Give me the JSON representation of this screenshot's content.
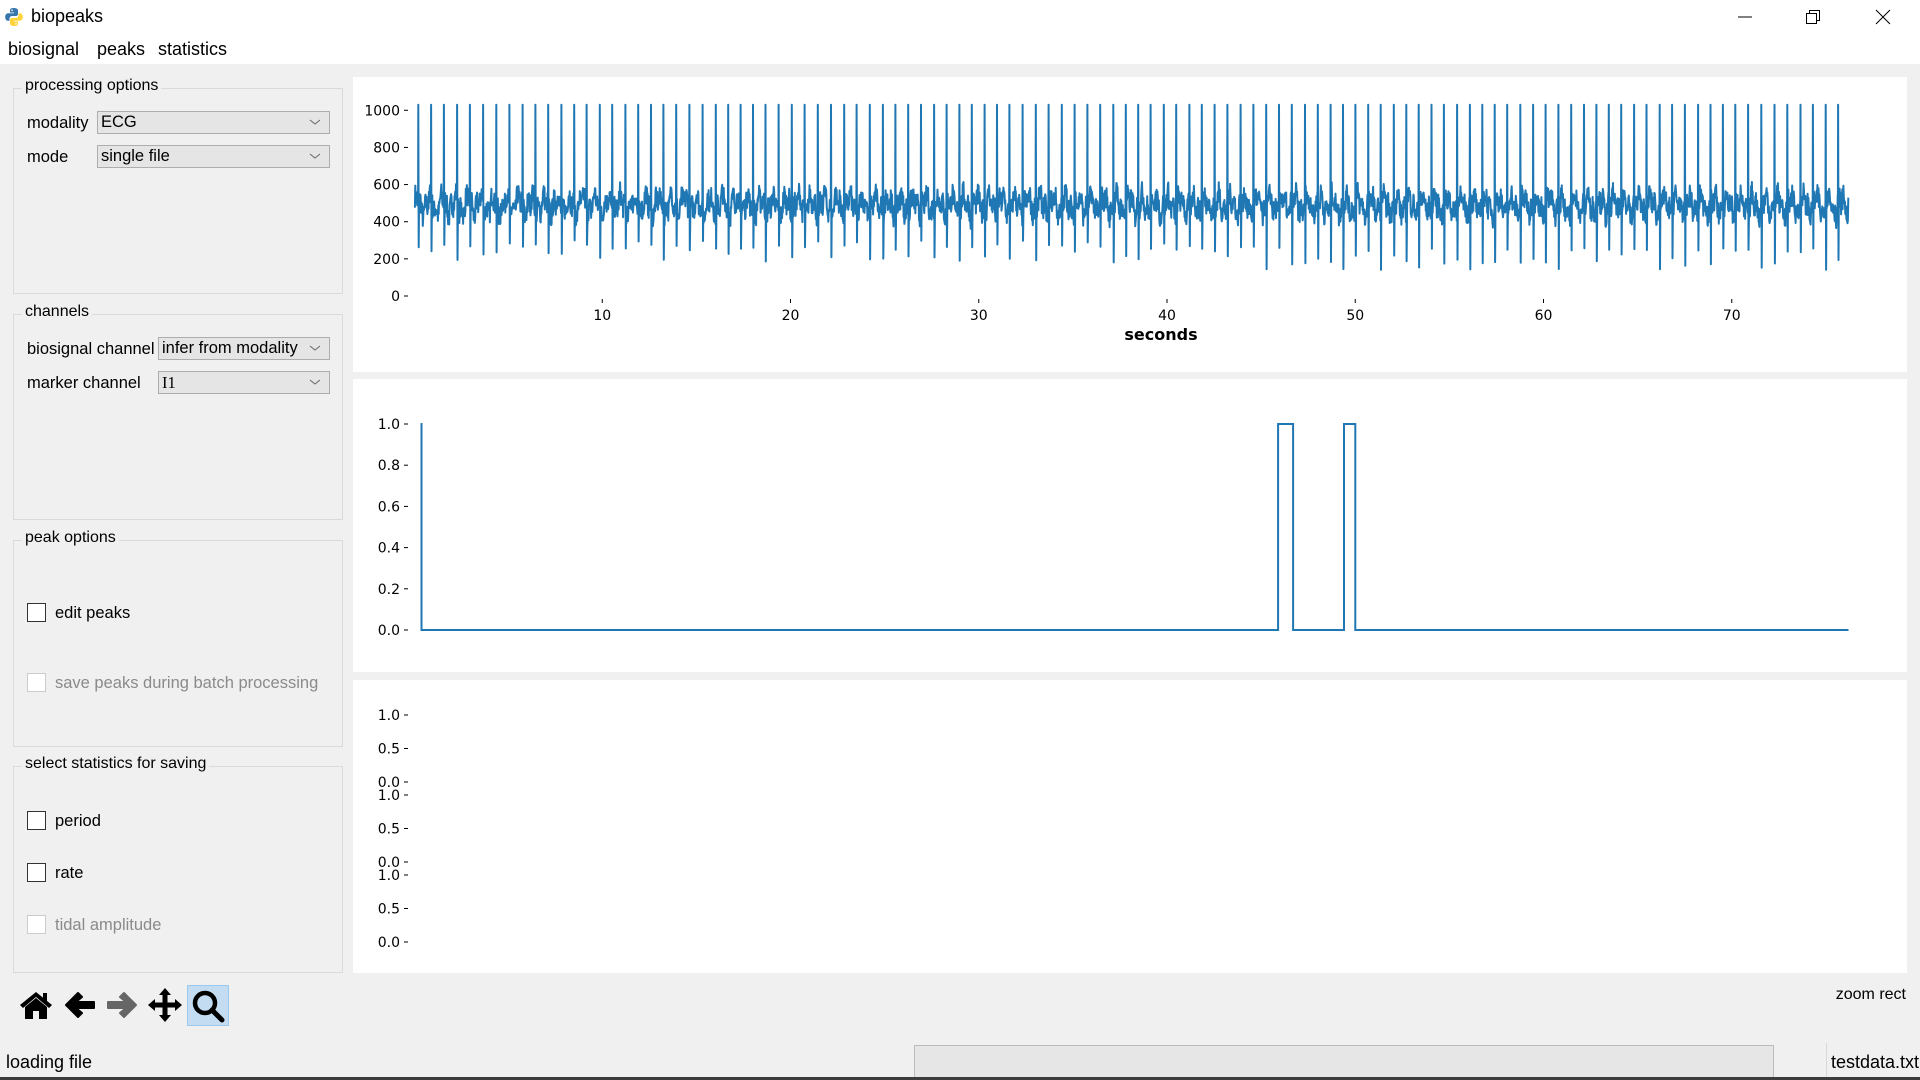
{
  "window": {
    "title": "biopeaks",
    "icon": "python-icon",
    "controls": {
      "minimize": "minimize-icon",
      "maximize": "restore-icon",
      "close": "close-icon"
    }
  },
  "menubar": {
    "items": [
      {
        "label": "biosignal"
      },
      {
        "label": "peaks"
      },
      {
        "label": "statistics"
      }
    ]
  },
  "panels": {
    "processing_options": {
      "title": "processing options",
      "modality_label": "modality",
      "modality_value": "ECG",
      "mode_label": "mode",
      "mode_value": "single file"
    },
    "channels": {
      "title": "channels",
      "biosignal_label": "biosignal channel",
      "biosignal_value": "infer from modality",
      "marker_label": "marker channel",
      "marker_value": "I1"
    },
    "peak_options": {
      "title": "peak options",
      "edit_peaks": {
        "label": "edit peaks",
        "checked": false,
        "enabled": true
      },
      "save_peaks_batch": {
        "label": "save peaks during batch processing",
        "checked": false,
        "enabled": false
      }
    },
    "statistics": {
      "title": "select statistics for saving",
      "period": {
        "label": "period",
        "checked": false,
        "enabled": true
      },
      "rate": {
        "label": "rate",
        "checked": false,
        "enabled": true
      },
      "tidal_amplitude": {
        "label": "tidal amplitude",
        "checked": false,
        "enabled": false
      }
    }
  },
  "toolbar": {
    "buttons": [
      {
        "name": "home",
        "icon": "home-icon",
        "enabled": true,
        "active": false
      },
      {
        "name": "back",
        "icon": "arrow-left-icon",
        "enabled": true,
        "active": false
      },
      {
        "name": "forward",
        "icon": "arrow-right-icon",
        "enabled": false,
        "active": false
      },
      {
        "name": "pan",
        "icon": "move-icon",
        "enabled": true,
        "active": false
      },
      {
        "name": "zoom",
        "icon": "magnifier-icon",
        "enabled": true,
        "active": true
      }
    ],
    "mode_text": "zoom rect"
  },
  "statusbar": {
    "message": "loading file",
    "progress": 0,
    "file": "testdata.txt"
  },
  "colors": {
    "line": "#1f77b4",
    "active_tool": "#c4dcf2"
  },
  "chart_data": [
    {
      "type": "line",
      "name": "biosignal",
      "title": "",
      "xlabel": "seconds",
      "ylabel": "",
      "xlim": [
        0,
        78.3
      ],
      "ylim": [
        0,
        1050
      ],
      "xticks": [
        10,
        20,
        30,
        40,
        50,
        60,
        70
      ],
      "yticks": [
        0,
        200,
        400,
        600,
        800,
        1000
      ],
      "ytick_labels": [
        "0",
        "200",
        "400",
        "600",
        "800",
        "1000"
      ],
      "series": [
        {
          "name": "ECG",
          "description": "ECG trace, ~0.68 s beat interval, R peaks ~1030, S troughs ~200-250, baseline ~450-550",
          "t_start": 0.05,
          "t_end": 76.2,
          "r_peak_value": 1030,
          "baseline": 490,
          "beat_interval_s": 0.68,
          "s_trough_range": [
            180,
            300
          ]
        }
      ]
    },
    {
      "type": "line",
      "name": "marker",
      "title": "",
      "xlabel": "",
      "ylabel": "",
      "xlim": [
        0,
        78.3
      ],
      "ylim": [
        -0.05,
        1.05
      ],
      "yticks": [
        0.0,
        0.2,
        0.4,
        0.6,
        0.8,
        1.0
      ],
      "ytick_labels": [
        "0.0",
        "0.2",
        "0.4",
        "0.6",
        "0.8",
        "1.0"
      ],
      "series": [
        {
          "name": "I1",
          "x": [
            0.35,
            0.4,
            0.4,
            45.9,
            45.9,
            46.7,
            46.7,
            49.4,
            49.4,
            50.0,
            50.0,
            76.2
          ],
          "y": [
            1,
            1,
            0,
            0,
            1,
            1,
            0,
            0,
            1,
            1,
            0,
            0
          ]
        }
      ]
    },
    {
      "type": "line",
      "name": "statistics",
      "title": "",
      "subplots": [
        {
          "yticks": [
            0.0,
            0.5,
            1.0
          ],
          "ytick_labels": [
            "0.0",
            "0.5",
            "1.0"
          ]
        },
        {
          "yticks": [
            0.0,
            0.5,
            1.0
          ],
          "ytick_labels": [
            "0.0",
            "0.5",
            "1.0"
          ]
        },
        {
          "yticks": [
            0.0,
            0.5,
            1.0
          ],
          "ytick_labels": [
            "0.0",
            "0.5",
            "1.0"
          ]
        }
      ],
      "series": []
    }
  ]
}
